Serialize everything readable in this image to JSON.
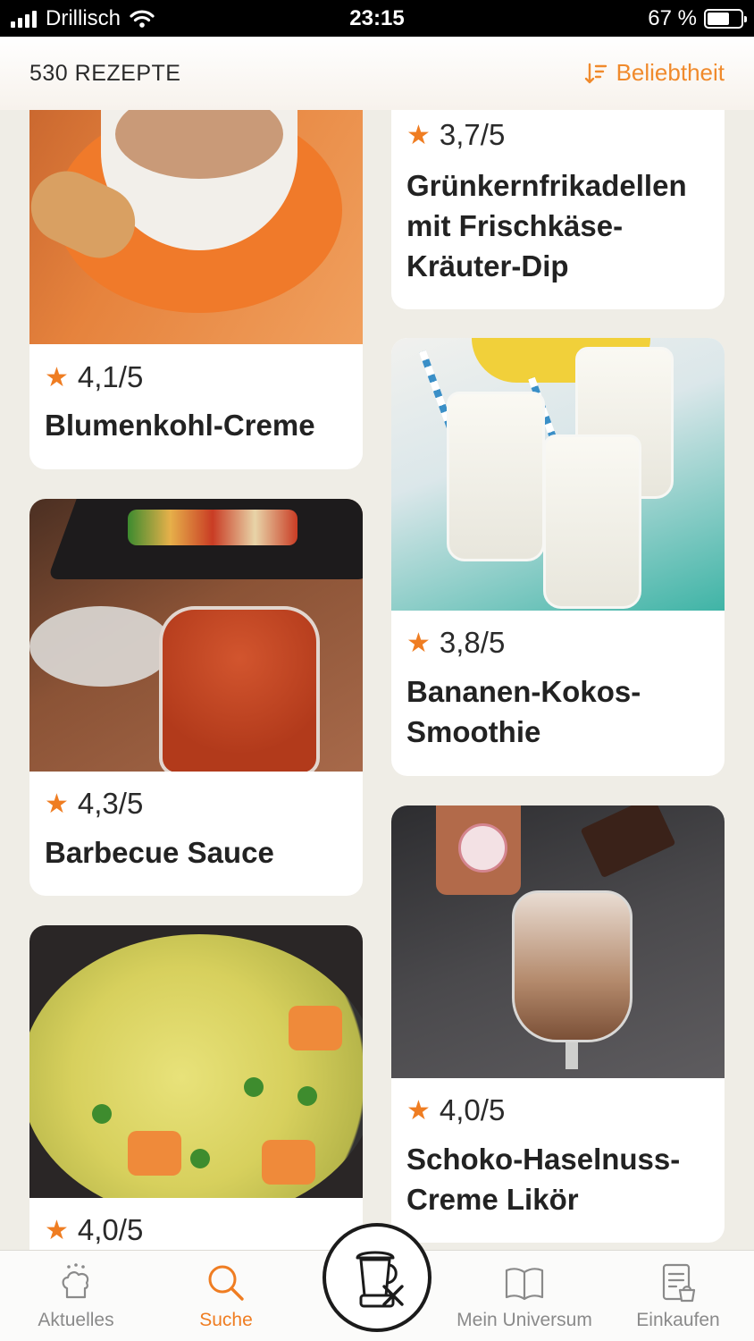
{
  "status_bar": {
    "carrier": "Drillisch",
    "time": "23:15",
    "battery": "67 %",
    "battery_level": 0.67
  },
  "header": {
    "count_label": "530 REZEPTE",
    "sort_label": "Beliebtheit",
    "sort_icon": "sort-icon"
  },
  "recipes": [
    {
      "rating": "4,1/5",
      "title": "Blumenkohl-Creme",
      "image": "soup-image"
    },
    {
      "rating": "3,7/5",
      "title": "Grünkernfrikadellen mit Frischkäse-Kräuter-Dip",
      "image": ""
    },
    {
      "rating": "4,3/5",
      "title": "Barbecue Sauce",
      "image": "bbq-sauce-image"
    },
    {
      "rating": "3,8/5",
      "title": "Bananen-Kokos-Smoothie",
      "image": "smoothie-image"
    },
    {
      "rating": "4,0/5",
      "title": "",
      "image": "vegetable-curry-image"
    },
    {
      "rating": "4,0/5",
      "title": "Schoko-Haselnuss-Creme Likör",
      "image": "chocolate-liqueur-image"
    }
  ],
  "tabs": [
    {
      "label": "Aktuelles",
      "icon": "chef-hat-icon",
      "active": false
    },
    {
      "label": "Suche",
      "icon": "search-icon",
      "active": true
    },
    {
      "label": "Mein Universum",
      "icon": "book-icon",
      "active": false
    },
    {
      "label": "Einkaufen",
      "icon": "shopping-list-icon",
      "active": false
    }
  ],
  "center_button": {
    "icon": "thermomix-icon"
  },
  "colors": {
    "accent": "#ef7d22",
    "background": "#efede6"
  }
}
